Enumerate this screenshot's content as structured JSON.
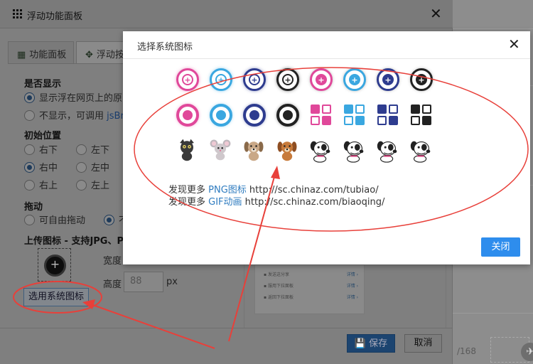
{
  "panel": {
    "title": "浮动功能面板",
    "tabs": [
      {
        "label": "功能面板"
      },
      {
        "label": "浮动按"
      }
    ],
    "show_section": {
      "title": "是否显示",
      "options": [
        {
          "label": "显示浮在网页上的原",
          "selected": true
        },
        {
          "label_prefix": "不显示，可调用 ",
          "label_link": "jsBr",
          "selected": false
        }
      ]
    },
    "position_section": {
      "title": "初始位置",
      "options": [
        {
          "label": "右下",
          "selected": false
        },
        {
          "label": "左下",
          "selected": false
        },
        {
          "label": "右中",
          "selected": true
        },
        {
          "label": "左中",
          "selected": false
        },
        {
          "label": "右上",
          "selected": false
        },
        {
          "label": "左上",
          "selected": false
        }
      ]
    },
    "drag_section": {
      "title": "拖动",
      "options": [
        {
          "label": "可自由拖动",
          "selected": false
        },
        {
          "label": "不",
          "selected": true
        }
      ]
    },
    "upload": {
      "title": "上传图标 - 支持JPG、PNG",
      "width_label": "宽度",
      "height_label": "高度",
      "height_value": "88",
      "unit": "px",
      "system_icon_button": "选用系统图标"
    },
    "preview_rows": [
      {
        "text": "▪ 发送这分享",
        "link": "详情 ›"
      },
      {
        "text": "▪ 服用下拉面板",
        "link": "详情 ›"
      },
      {
        "text": "▪ 返回下拉面板",
        "link": "详情 ›"
      }
    ],
    "save_label": "保存",
    "cancel_label": "取消"
  },
  "modal": {
    "title": "选择系统图标",
    "rings": [
      {
        "color": "#e0489a",
        "style": "soft"
      },
      {
        "color": "#3aa7e0",
        "style": "soft"
      },
      {
        "color": "#2e3c8f",
        "style": "soft"
      },
      {
        "color": "#222222",
        "style": "soft"
      },
      {
        "color": "#e0489a",
        "style": "dot"
      },
      {
        "color": "#3aa7e0",
        "style": "dot"
      },
      {
        "color": "#2e3c8f",
        "style": "dot"
      },
      {
        "color": "#222222",
        "style": "dot"
      }
    ],
    "solid_rings": [
      {
        "color": "#e0489a"
      },
      {
        "color": "#3aa7e0"
      },
      {
        "color": "#2e3c8f"
      },
      {
        "color": "#222222"
      }
    ],
    "grids": [
      {
        "color": "#e0489a"
      },
      {
        "color": "#3aa7e0"
      },
      {
        "color": "#2e3c8f"
      },
      {
        "color": "#222222"
      }
    ],
    "animals": [
      "cat-icon",
      "mouse-icon",
      "dog-tan-icon",
      "dog-brown-icon",
      "puppy-icon",
      "puppy-icon",
      "puppy-icon",
      "puppy-icon"
    ],
    "link1": {
      "prefix": "发现更多 ",
      "type": "PNG图标",
      "url": " http://sc.chinaz.com/tubiao/"
    },
    "link2": {
      "prefix": "发现更多 ",
      "type": "GIF动画",
      "url": " http://sc.chinaz.com/biaoqing/"
    },
    "close_label": "关闭"
  },
  "background": {
    "counter": "/168"
  },
  "colors": {
    "accent": "#2e8ded",
    "annotation": "#e8403a"
  }
}
